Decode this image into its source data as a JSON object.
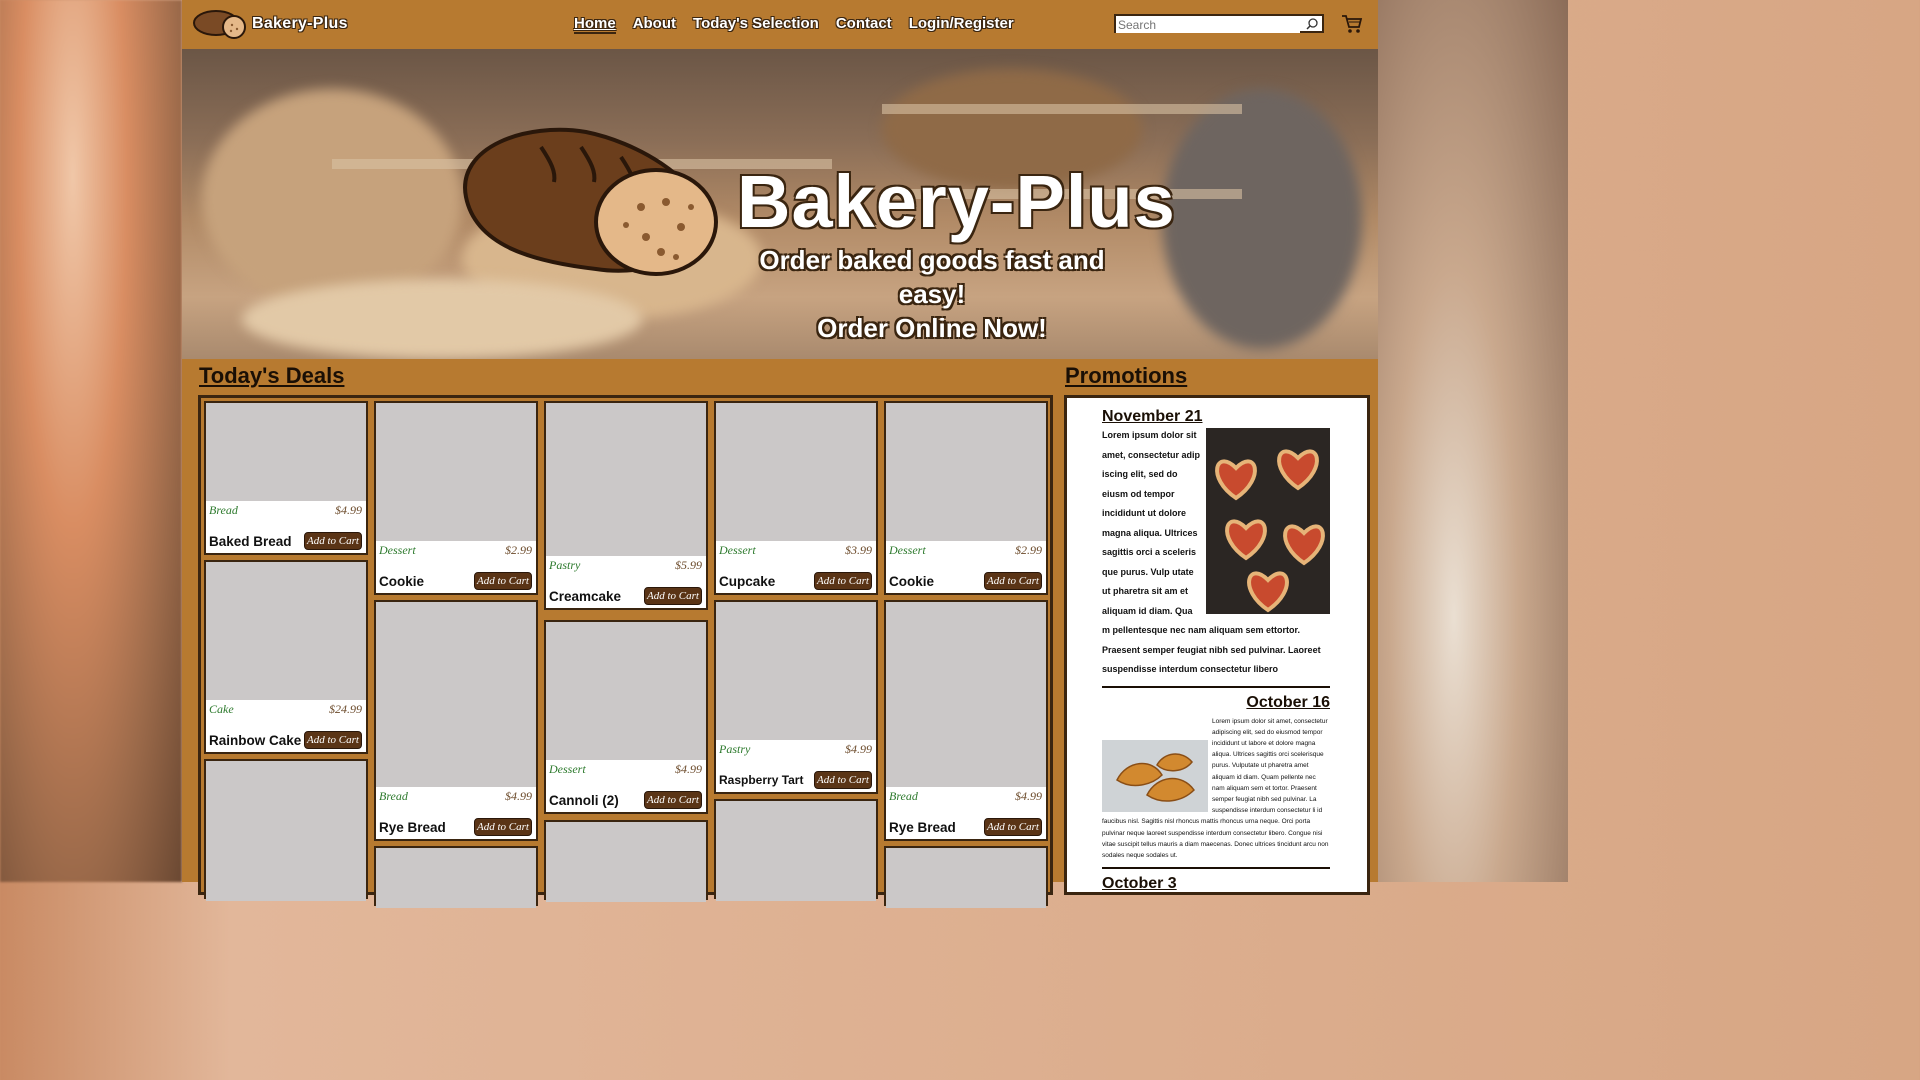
{
  "brand": {
    "name": "Bakery-Plus"
  },
  "nav": {
    "items": [
      "Home",
      "About",
      "Today's Selection",
      "Contact",
      "Login/Register"
    ],
    "active": "Home",
    "search_placeholder": "Search"
  },
  "hero": {
    "title": "Bakery-Plus",
    "subtitle_line1": "Order baked goods fast and easy!",
    "subtitle_line2": "Order Online Now!"
  },
  "deals": {
    "title": "Today's Deals",
    "add_label": "Add to Cart",
    "cards": [
      {
        "category": "Bread",
        "price": "$4.99",
        "name": "Baked Bread"
      },
      {
        "category": "Cake",
        "price": "$24.99",
        "name": "Rainbow Cake"
      },
      {
        "category": "Dessert",
        "price": "$2.99",
        "name": "Cookie"
      },
      {
        "category": "Bread",
        "price": "$4.99",
        "name": "Rye Bread"
      },
      {
        "category": "Pastry",
        "price": "$5.99",
        "name": "Creamcake"
      },
      {
        "category": "Dessert",
        "price": "$4.99",
        "name": "Cannoli (2)"
      },
      {
        "category": "Dessert",
        "price": "$3.99",
        "name": "Cupcake"
      },
      {
        "category": "Pastry",
        "price": "$4.99",
        "name": "Raspberry Tart"
      },
      {
        "category": "Dessert",
        "price": "$2.99",
        "name": "Cookie"
      },
      {
        "category": "Bread",
        "price": "$4.99",
        "name": "Rye Bread"
      }
    ]
  },
  "promotions": {
    "title": "Promotions",
    "items": [
      {
        "date": "November 21",
        "text": "Lorem ipsum dolor sit amet, consectetur adip iscing elit, sed do eiusm od tempor incididunt ut dolore magna aliqua. Ultrices sagittis orci a sceleris que purus. Vulp utate ut pharetra sit am et aliquam id diam. Qua m pellentesque nec nam aliquam sem ettortor. Praesent semper feugiat nibh sed pulvinar. Laoreet suspendisse interdum consectetur libero"
      },
      {
        "date": "October 16",
        "text": "Lorem ipsum dolor sit amet, consectetur adipiscing elit, sed do eiusmod tempor incididunt ut labore et dolore magna aliqua. Ultrices sagittis orci scelerisque purus. Vulputate ut pharetra amet aliquam id diam. Quam pellente nec nam aliquam sem et tortor. Praesent semper feugiat nibh sed pulvinar. La suspendisse interdum consectetur li id faucibus nisl. Sagittis nisl rhoncus mattis rhoncus urna neque. Orci porta pulvinar neque laoreet suspendisse interdum consectetur libero. Congue nisi vitae suscipit tellus mauris a diam maecenas. Donec ultrices tincidunt arcu non sodales neque sodales ut."
      },
      {
        "date": "October 3"
      }
    ]
  }
}
